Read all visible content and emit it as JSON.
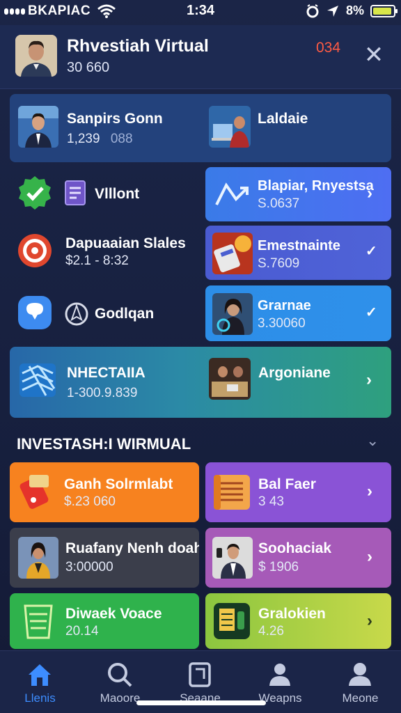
{
  "status_bar": {
    "carrier": "BKAPIAC",
    "time": "1:34",
    "battery": "8%",
    "battery_level": 0.8,
    "icons": [
      "signal-dots-icon",
      "wifi-icon",
      "alarm-icon",
      "location-icon",
      "battery-icon"
    ]
  },
  "header": {
    "title": "Rhvestiah Virtual",
    "subtitle": "30 660",
    "badge": "034",
    "close": "✕"
  },
  "cards": {
    "c1": {
      "title": "Sanpirs Gonn",
      "sub": "1,239",
      "sub2": "088"
    },
    "c2": {
      "title": "Laldaie"
    },
    "r2_left": {
      "title": "Vlllont"
    },
    "c3": {
      "title": "Blapiar, Rnyestsa",
      "sub": "S.0637"
    },
    "r3_left": {
      "title": "Dapuaaian Slales",
      "sub": "$2.1 - 8:32"
    },
    "c4": {
      "title": "Emestnainte",
      "sub": "S.7609"
    },
    "r4_left": {
      "title": "Godlqan"
    },
    "c5": {
      "title": "Grarnae",
      "sub": "3.30060"
    },
    "c6": {
      "title": "NHECTAIIA",
      "sub": "1-300.9.839"
    },
    "c6b": {
      "title": "Argoniane"
    }
  },
  "section": {
    "title": "INVESTASH:I WIRMUAL"
  },
  "grid": [
    {
      "title": "Ganh Solrmlabt",
      "sub": "$.23 060",
      "color": "#f7821f"
    },
    {
      "title": "Bal Faer",
      "sub": "3 43",
      "color": "#8a53d6"
    },
    {
      "title": "Ruafany Nenh doah",
      "sub": "3:00000",
      "color": "#3b3e4b"
    },
    {
      "title": "Soohaciak",
      "sub": "$ 1906",
      "color": "#a65ab8"
    },
    {
      "title": "Diwaek Voace",
      "sub": "20.14",
      "color": "#2fb24c"
    },
    {
      "title": "Gralokien",
      "sub": "4.26",
      "color": "#b3cd3e"
    }
  ],
  "tabs": [
    {
      "label": "Llenis",
      "icon": "home-icon",
      "active": true
    },
    {
      "label": "Maoore",
      "icon": "search-icon"
    },
    {
      "label": "Seaane",
      "icon": "tablet-icon"
    },
    {
      "label": "Weapns",
      "icon": "people-icon"
    },
    {
      "label": "Meone",
      "icon": "profile-icon"
    }
  ]
}
